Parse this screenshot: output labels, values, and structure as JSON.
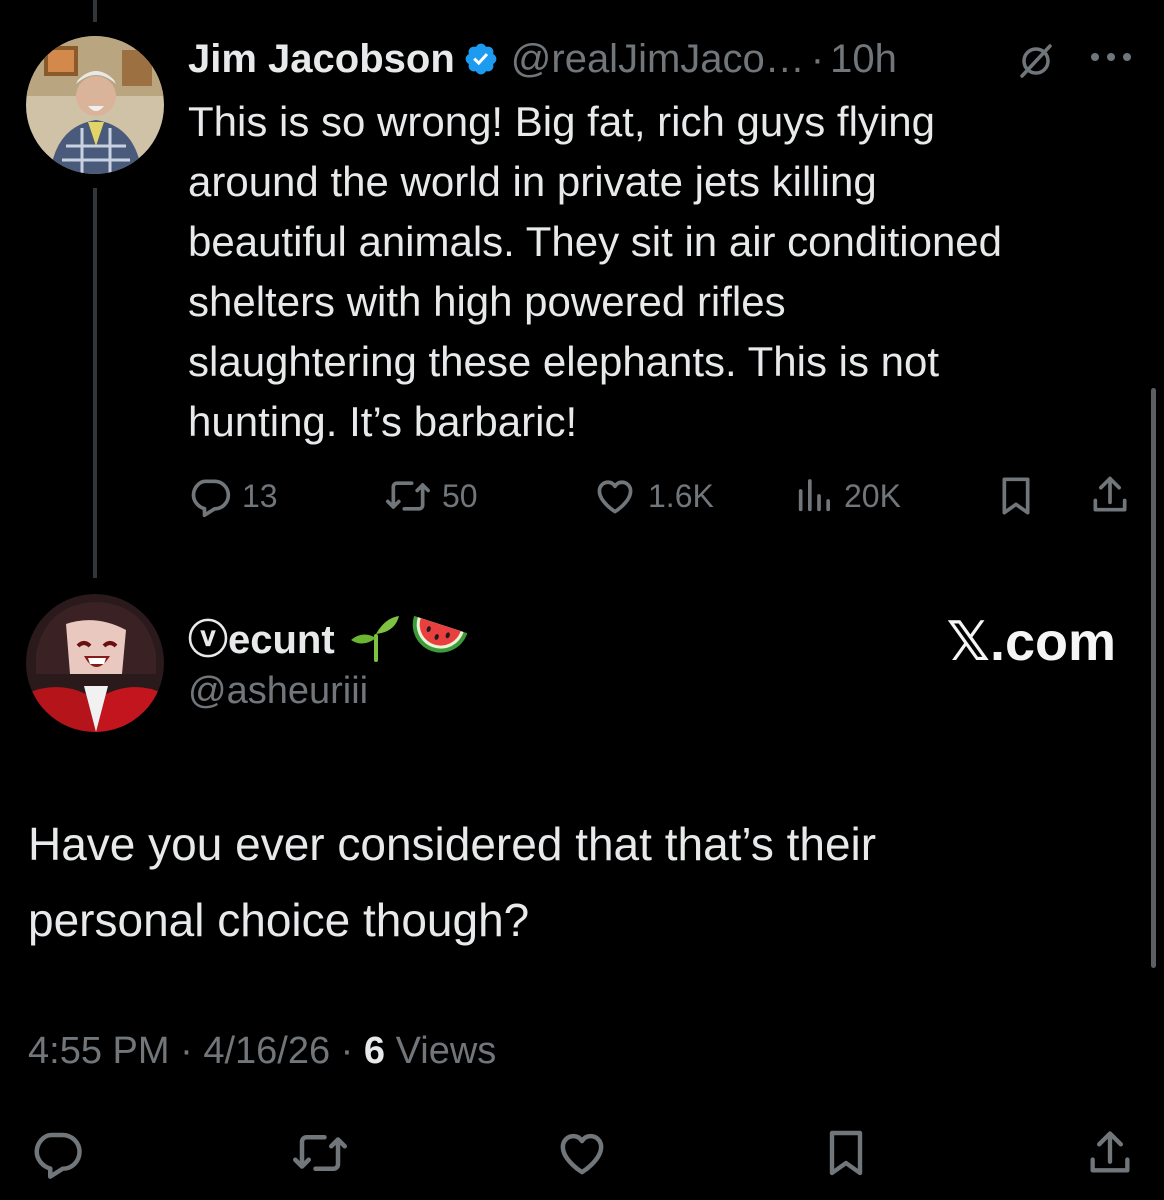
{
  "tweet": {
    "author_name": "Jim Jacobson",
    "handle": "@realJimJaco…",
    "separator": "·",
    "time": "10h",
    "text": "This is so wrong!  Big fat, rich guys flying\naround the world in private jets killing\nbeautiful animals. They sit in air conditioned\nshelters with high powered rifles\nslaughtering these elephants.  This is not\nhunting.  It’s barbaric!",
    "stats": {
      "replies": "13",
      "reposts": "50",
      "likes": "1.6K",
      "views": "20K"
    },
    "icons": [
      "verified-badge-icon",
      "muted-icon",
      "more-icon",
      "reply-icon",
      "repost-icon",
      "like-icon",
      "views-icon",
      "bookmark-icon",
      "share-icon"
    ]
  },
  "reply": {
    "display_name": "ⓥecunt",
    "emojis": [
      "🌱",
      "🍉"
    ],
    "handle": "@asheuriii",
    "brand": "𝕏.com",
    "text": "Have you ever considered that that’s their\npersonal choice though?",
    "time": "4:55 PM",
    "date": "4/16/26",
    "separator": "·",
    "views_count": "6",
    "views_label": "Views"
  },
  "colors": {
    "background": "#000000",
    "text": "#e7e9ea",
    "muted": "#71767b",
    "verified": "#1d9bf0",
    "thread_line": "#333639"
  }
}
